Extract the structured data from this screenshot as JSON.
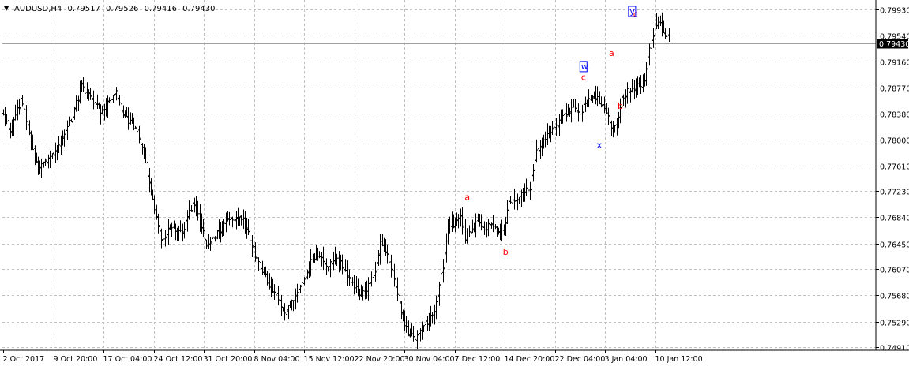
{
  "header": {
    "dropdown_glyph": "▼",
    "symbol": "AUDUSD,H4",
    "open": "0.79517",
    "high": "0.79526",
    "low": "0.79416",
    "close": "0.79430"
  },
  "colors": {
    "background": "#ffffff",
    "grid": "#c0c0c0",
    "bars": "#000000",
    "price_line": "#a0a0a0",
    "price_tag_bg": "#000000",
    "price_tag_text": "#ffffff",
    "wave_red": "#ff0000",
    "wave_blue": "#0000ff"
  },
  "chart_data": {
    "type": "ohlc",
    "symbol": "AUDUSD",
    "timeframe": "H4",
    "ylim": [
      0.7491,
      0.7993
    ],
    "y_ticks": [
      "0.79930",
      "0.79540",
      "0.79160",
      "0.78770",
      "0.78380",
      "0.78000",
      "0.77610",
      "0.77230",
      "0.76840",
      "0.76450",
      "0.76070",
      "0.75680",
      "0.75290",
      "0.74910"
    ],
    "x_ticks": [
      "2 Oct 2017",
      "9 Oct 20:00",
      "17 Oct 04:00",
      "24 Oct 12:00",
      "31 Oct 20:00",
      "8 Nov 04:00",
      "15 Nov 12:00",
      "22 Nov 20:00",
      "30 Nov 04:00",
      "7 Dec 12:00",
      "14 Dec 20:00",
      "22 Dec 04:00",
      "3 Jan 04:00",
      "10 Jan 12:00"
    ],
    "grid": true,
    "current_price": "0.79430",
    "close_path": [
      {
        "bar": 0,
        "close": 0.7838
      },
      {
        "bar": 4,
        "close": 0.7808
      },
      {
        "bar": 10,
        "close": 0.786
      },
      {
        "bar": 14,
        "close": 0.7822
      },
      {
        "bar": 20,
        "close": 0.7755
      },
      {
        "bar": 27,
        "close": 0.7775
      },
      {
        "bar": 32,
        "close": 0.779
      },
      {
        "bar": 37,
        "close": 0.7816
      },
      {
        "bar": 42,
        "close": 0.7852
      },
      {
        "bar": 45,
        "close": 0.7878
      },
      {
        "bar": 50,
        "close": 0.7862
      },
      {
        "bar": 56,
        "close": 0.7842
      },
      {
        "bar": 61,
        "close": 0.7858
      },
      {
        "bar": 65,
        "close": 0.787
      },
      {
        "bar": 70,
        "close": 0.7832
      },
      {
        "bar": 76,
        "close": 0.7818
      },
      {
        "bar": 80,
        "close": 0.779
      },
      {
        "bar": 85,
        "close": 0.772
      },
      {
        "bar": 91,
        "close": 0.765
      },
      {
        "bar": 97,
        "close": 0.7672
      },
      {
        "bar": 103,
        "close": 0.766
      },
      {
        "bar": 109,
        "close": 0.7705
      },
      {
        "bar": 113,
        "close": 0.768
      },
      {
        "bar": 117,
        "close": 0.7645
      },
      {
        "bar": 122,
        "close": 0.7658
      },
      {
        "bar": 127,
        "close": 0.7672
      },
      {
        "bar": 132,
        "close": 0.7682
      },
      {
        "bar": 137,
        "close": 0.7685
      },
      {
        "bar": 141,
        "close": 0.766
      },
      {
        "bar": 146,
        "close": 0.762
      },
      {
        "bar": 152,
        "close": 0.759
      },
      {
        "bar": 157,
        "close": 0.7565
      },
      {
        "bar": 162,
        "close": 0.7545
      },
      {
        "bar": 167,
        "close": 0.756
      },
      {
        "bar": 172,
        "close": 0.7585
      },
      {
        "bar": 177,
        "close": 0.7618
      },
      {
        "bar": 182,
        "close": 0.7625
      },
      {
        "bar": 187,
        "close": 0.761
      },
      {
        "bar": 192,
        "close": 0.7626
      },
      {
        "bar": 196,
        "close": 0.7605
      },
      {
        "bar": 200,
        "close": 0.759
      },
      {
        "bar": 205,
        "close": 0.757
      },
      {
        "bar": 209,
        "close": 0.7578
      },
      {
        "bar": 213,
        "close": 0.7594
      },
      {
        "bar": 217,
        "close": 0.7642
      },
      {
        "bar": 221,
        "close": 0.763
      },
      {
        "bar": 225,
        "close": 0.759
      },
      {
        "bar": 229,
        "close": 0.7545
      },
      {
        "bar": 233,
        "close": 0.751
      },
      {
        "bar": 237,
        "close": 0.7502
      },
      {
        "bar": 241,
        "close": 0.7522
      },
      {
        "bar": 245,
        "close": 0.7528
      },
      {
        "bar": 249,
        "close": 0.7555
      },
      {
        "bar": 253,
        "close": 0.761
      },
      {
        "bar": 256,
        "close": 0.7672
      },
      {
        "bar": 260,
        "close": 0.7676
      },
      {
        "bar": 263,
        "close": 0.7685
      },
      {
        "bar": 266,
        "close": 0.765
      },
      {
        "bar": 270,
        "close": 0.7668
      },
      {
        "bar": 273,
        "close": 0.7675
      },
      {
        "bar": 277,
        "close": 0.7668
      },
      {
        "bar": 281,
        "close": 0.7672
      },
      {
        "bar": 285,
        "close": 0.7665
      },
      {
        "bar": 288,
        "close": 0.766
      },
      {
        "bar": 291,
        "close": 0.7705
      },
      {
        "bar": 295,
        "close": 0.771
      },
      {
        "bar": 299,
        "close": 0.7718
      },
      {
        "bar": 303,
        "close": 0.773
      },
      {
        "bar": 307,
        "close": 0.778
      },
      {
        "bar": 312,
        "close": 0.7802
      },
      {
        "bar": 316,
        "close": 0.7815
      },
      {
        "bar": 320,
        "close": 0.7825
      },
      {
        "bar": 324,
        "close": 0.7838
      },
      {
        "bar": 328,
        "close": 0.7845
      },
      {
        "bar": 332,
        "close": 0.784
      },
      {
        "bar": 336,
        "close": 0.7855
      },
      {
        "bar": 340,
        "close": 0.787
      },
      {
        "bar": 344,
        "close": 0.785
      },
      {
        "bar": 347,
        "close": 0.784
      },
      {
        "bar": 350,
        "close": 0.7818
      },
      {
        "bar": 353,
        "close": 0.7822
      },
      {
        "bar": 356,
        "close": 0.786
      },
      {
        "bar": 359,
        "close": 0.7872
      },
      {
        "bar": 362,
        "close": 0.787
      },
      {
        "bar": 365,
        "close": 0.7885
      },
      {
        "bar": 368,
        "close": 0.7878
      },
      {
        "bar": 372,
        "close": 0.7935
      },
      {
        "bar": 375,
        "close": 0.7968
      },
      {
        "bar": 378,
        "close": 0.797
      },
      {
        "bar": 381,
        "close": 0.7955
      },
      {
        "bar": 383,
        "close": 0.7943
      }
    ],
    "annotations": [
      {
        "label": "a",
        "color": "red",
        "bar": 267,
        "price": 0.771
      },
      {
        "label": "b",
        "color": "red",
        "bar": 289,
        "price": 0.7628
      },
      {
        "label": "c",
        "color": "red",
        "bar": 334,
        "price": 0.7888
      },
      {
        "label": "w",
        "color": "blue",
        "bar": 334,
        "price": 0.7904,
        "boxed": true
      },
      {
        "label": "x",
        "color": "blue",
        "bar": 343,
        "price": 0.7787
      },
      {
        "label": "a",
        "color": "red",
        "bar": 350,
        "price": 0.7924
      },
      {
        "label": "b",
        "color": "red",
        "bar": 355,
        "price": 0.7845
      },
      {
        "label": "c",
        "color": "red",
        "bar": 364,
        "price": 0.7982
      },
      {
        "label": "y",
        "color": "blue",
        "bar": 362,
        "price": 0.7986,
        "boxed": true
      }
    ]
  }
}
